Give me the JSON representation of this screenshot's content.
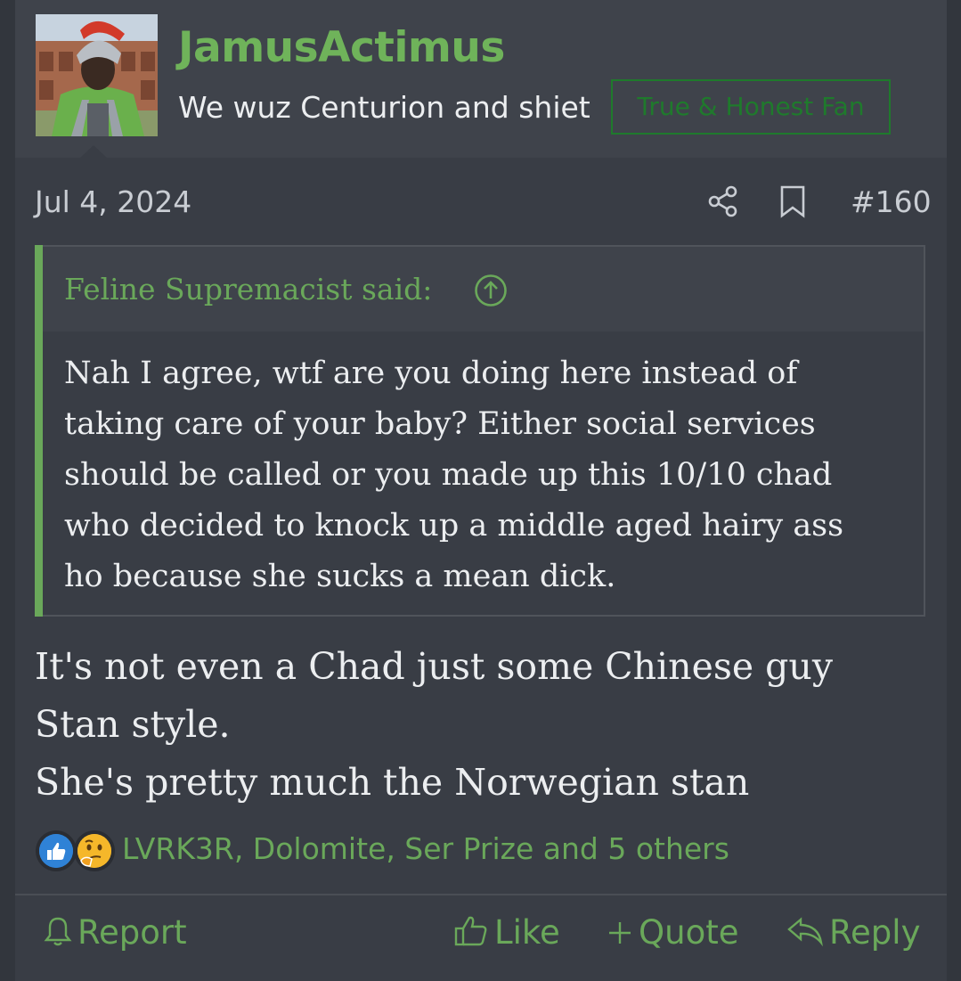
{
  "post": {
    "username": "JamusActimus",
    "user_title": "We wuz Centurion and shiet",
    "user_badge": "True & Honest Fan",
    "date": "Jul 4, 2024",
    "post_number": "#160",
    "quote": {
      "attribution": "Feline Supremacist said:",
      "lines": [
        "Nah I agree, wtf are you doing here instead of",
        "taking care of your baby? Either social services",
        "should be called or you made up this 10/10 chad",
        "who decided to knock up a middle aged hairy ass",
        "ho because she sucks a mean dick."
      ]
    },
    "message_lines": [
      "It's not even a Chad just some Chinese guy",
      "Stan style.",
      "She's pretty much the Norwegian stan"
    ],
    "reactions": {
      "icons": [
        "thumbs-up-reaction-icon",
        "thinking-face-reaction-icon"
      ],
      "names": "LVRK3R, Dolomite, Ser Prize and 5 others"
    },
    "actions": {
      "report": "Report",
      "like": "Like",
      "quote": "Quote",
      "reply": "Reply"
    }
  },
  "colors": {
    "background": "#32363d",
    "post_bg": "#393d45",
    "userbar_bg": "#3f434b",
    "accent_green": "#6aa85a",
    "username_green": "#6fb35a",
    "badge_green": "#1f7a2c",
    "text": "#eceef0",
    "muted": "#c9cdd3"
  }
}
